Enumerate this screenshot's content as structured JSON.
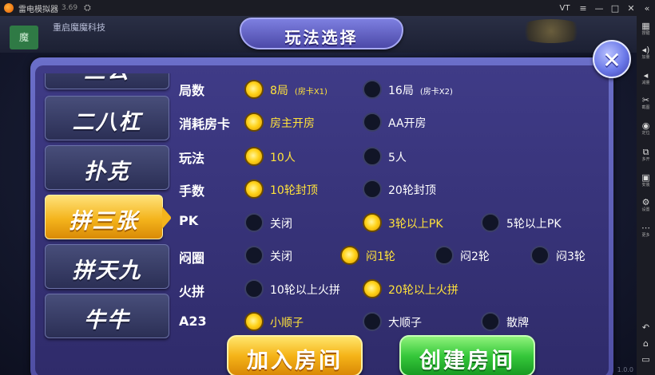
{
  "titlebar": {
    "app_name": "雷电模拟器",
    "version": "3.69",
    "controls": [
      "VT",
      "≡",
      "—",
      "□",
      "✕",
      "«"
    ]
  },
  "sidebar": {
    "items": [
      {
        "icon": "keyboard-icon",
        "glyph": "▦",
        "label": "按键"
      },
      {
        "icon": "volume-up-icon",
        "glyph": "◂)",
        "label": "加量"
      },
      {
        "icon": "volume-down-icon",
        "glyph": "◂",
        "label": "减量"
      },
      {
        "icon": "screenshot-icon",
        "glyph": "✂",
        "label": "截图"
      },
      {
        "icon": "location-icon",
        "glyph": "◉",
        "label": "定位"
      },
      {
        "icon": "multi-open-icon",
        "glyph": "⧉",
        "label": "多开"
      },
      {
        "icon": "install-icon",
        "glyph": "▣",
        "label": "安装"
      },
      {
        "icon": "settings-icon",
        "glyph": "⚙",
        "label": "设置"
      },
      {
        "icon": "more-icon",
        "glyph": "⋯",
        "label": "更多"
      }
    ],
    "nav": [
      {
        "icon": "back-icon",
        "glyph": "↶"
      },
      {
        "icon": "home-icon",
        "glyph": "⌂"
      },
      {
        "icon": "recent-icon",
        "glyph": "▭"
      }
    ]
  },
  "background": {
    "tag": "魔",
    "text": "重启魔魔科技"
  },
  "dialog": {
    "title": "玩法选择",
    "close_glyph": "✕"
  },
  "menu": {
    "items": [
      {
        "label": "三公"
      },
      {
        "label": "二八杠"
      },
      {
        "label": "扑克"
      },
      {
        "label": "拼三张",
        "active": true
      },
      {
        "label": "拼天九"
      },
      {
        "label": "牛牛"
      }
    ]
  },
  "rows": [
    {
      "label": "局数",
      "options": [
        {
          "text": "8局",
          "sub": "(房卡X1)",
          "selected": true
        },
        {
          "text": "16局",
          "sub": "(房卡X2)",
          "selected": false
        }
      ]
    },
    {
      "label": "消耗房卡",
      "options": [
        {
          "text": "房主开房",
          "selected": true
        },
        {
          "text": "AA开房",
          "selected": false
        }
      ]
    },
    {
      "label": "玩法",
      "options": [
        {
          "text": "10人",
          "selected": true
        },
        {
          "text": "5人",
          "selected": false
        }
      ]
    },
    {
      "label": "手数",
      "options": [
        {
          "text": "10轮封顶",
          "selected": true
        },
        {
          "text": "20轮封顶",
          "selected": false
        }
      ]
    },
    {
      "label": "PK",
      "options": [
        {
          "text": "关闭",
          "selected": false
        },
        {
          "text": "3轮以上PK",
          "selected": true
        },
        {
          "text": "5轮以上PK",
          "selected": false
        }
      ]
    },
    {
      "label": "闷圈",
      "options": [
        {
          "text": "关闭",
          "selected": false
        },
        {
          "text": "闷1轮",
          "selected": true
        },
        {
          "text": "闷2轮",
          "selected": false
        },
        {
          "text": "闷3轮",
          "selected": false
        }
      ]
    },
    {
      "label": "火拼",
      "options": [
        {
          "text": "10轮以上火拼",
          "selected": false
        },
        {
          "text": "20轮以上火拼",
          "selected": true
        }
      ]
    },
    {
      "label": "A23",
      "options": [
        {
          "text": "小顺子",
          "selected": true
        },
        {
          "text": "大顺子",
          "selected": false
        },
        {
          "text": "散牌",
          "selected": false
        }
      ]
    }
  ],
  "buttons": {
    "join": "加入房间",
    "create": "创建房间"
  },
  "corner_text": "1.0.0"
}
